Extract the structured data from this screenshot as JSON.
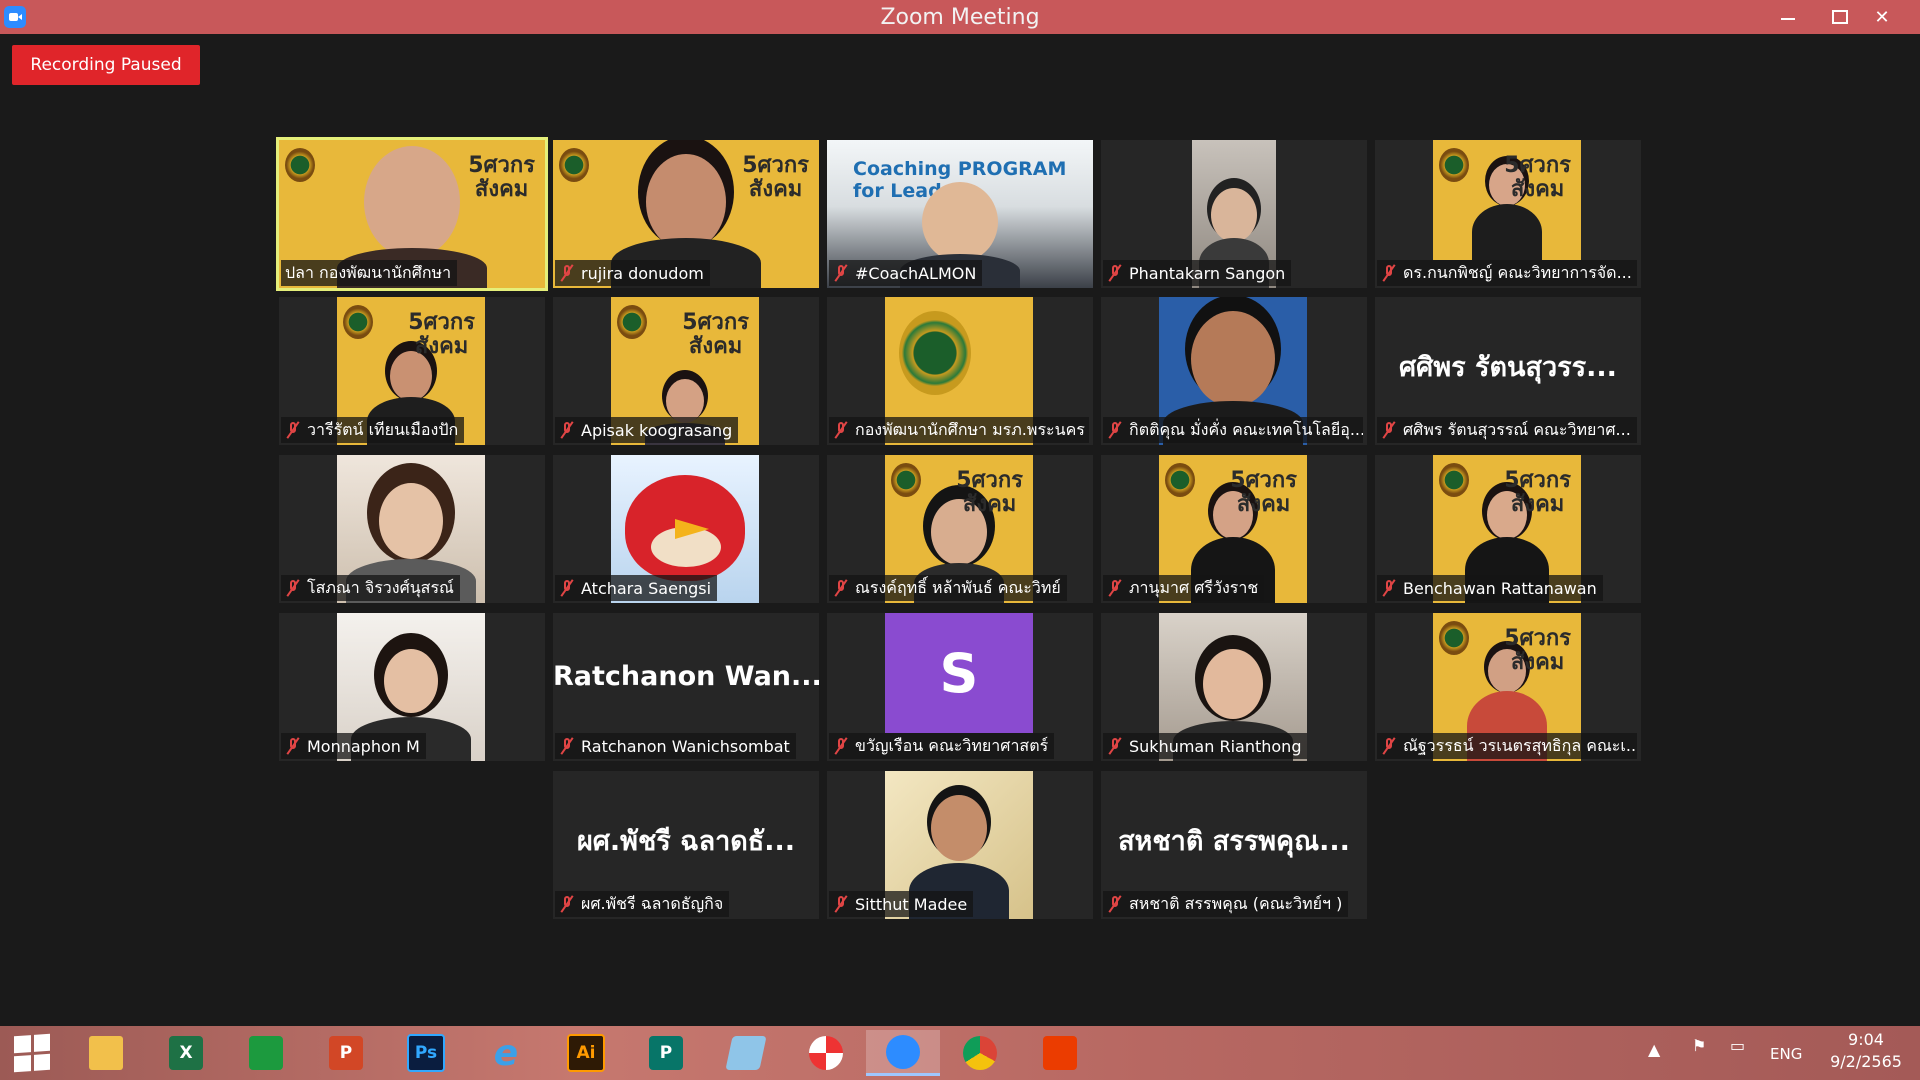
{
  "window": {
    "title": "Zoom Meeting",
    "minimize_icon": "minimize-icon",
    "maximize_icon": "restore-icon",
    "close_label": "✕"
  },
  "recording": {
    "label": "Recording Paused",
    "color": "#e0252a"
  },
  "active_speaker_color": "#e5ef7a",
  "participants": [
    {
      "name": "ปลา กองพัฒนานักศึกษา",
      "muted": false,
      "active": true
    },
    {
      "name": "rujira donudom",
      "muted": true
    },
    {
      "name": "#CoachALMON",
      "muted": true,
      "video_caption": "Coaching PROGRAM for Leader"
    },
    {
      "name": "Phantakarn Sangon",
      "muted": true
    },
    {
      "name": "ดร.กนกพิชญ์ คณะวิทยาการจัด...",
      "muted": true
    },
    {
      "name": "วารีรัตน์ เทียนเมืองปัก",
      "muted": true
    },
    {
      "name": "Apisak koograsang",
      "muted": true
    },
    {
      "name": "กองพัฒนานักศึกษา มรภ.พระนคร",
      "muted": true
    },
    {
      "name": "กิตติคุณ มั่งคั่ง คณะเทคโนโลยีอุ...",
      "muted": true
    },
    {
      "name": "ศศิพร รัตนสุวรรณ์ คณะวิทยาศ...",
      "muted": true,
      "display_name": "ศศิพร รัตนสุวรร..."
    },
    {
      "name": "โสภณา จิรวงศ์นุสรณ์",
      "muted": true
    },
    {
      "name": "Atchara Saengsi",
      "muted": true
    },
    {
      "name": "ณรงค์ฤทธิ์ หล้าพันธ์ คณะวิทย์",
      "muted": true
    },
    {
      "name": "ภานุมาศ ศรีวังราช",
      "muted": true
    },
    {
      "name": "Benchawan Rattanawan",
      "muted": true
    },
    {
      "name": "Monnaphon M",
      "muted": true
    },
    {
      "name": "Ratchanon Wanichsombat",
      "muted": true,
      "display_name": "Ratchanon Wan..."
    },
    {
      "name": "ขวัญเรือน คณะวิทยาศาสตร์",
      "muted": true,
      "avatar_letter": "S",
      "avatar_color": "#8a4bd0"
    },
    {
      "name": "Sukhuman Rianthong",
      "muted": true
    },
    {
      "name": "ณัฐวรรธน์ วรเนตรสุทธิกุล คณะเ...",
      "muted": true
    },
    {
      "name": "ผศ.พัชรี ฉลาดธัญกิจ",
      "muted": true,
      "display_name": "ผศ.พัชรี ฉลาดธั..."
    },
    {
      "name": "Sitthut Madee",
      "muted": true
    },
    {
      "name": "สหชาติ สรรพคุณ (คณะวิทย์ฯ )",
      "muted": true,
      "display_name": "สหชาติ สรรพคุณ..."
    }
  ],
  "taskbar": {
    "apps": [
      {
        "icon": "windows-start-icon"
      },
      {
        "icon": "file-explorer-icon"
      },
      {
        "icon": "excel-icon",
        "label": "X"
      },
      {
        "icon": "store-icon"
      },
      {
        "icon": "powerpoint-icon",
        "label": "P"
      },
      {
        "icon": "photoshop-icon",
        "label": "Ps"
      },
      {
        "icon": "internet-explorer-icon",
        "label": "e"
      },
      {
        "icon": "illustrator-icon",
        "label": "Ai"
      },
      {
        "icon": "publisher-icon",
        "label": "P"
      },
      {
        "icon": "notepad-icon"
      },
      {
        "icon": "photoscape-icon"
      },
      {
        "icon": "zoom-icon"
      },
      {
        "icon": "chrome-icon"
      },
      {
        "icon": "office-icon"
      }
    ],
    "language": "ENG",
    "time": "9:04",
    "date": "9/2/2565"
  }
}
